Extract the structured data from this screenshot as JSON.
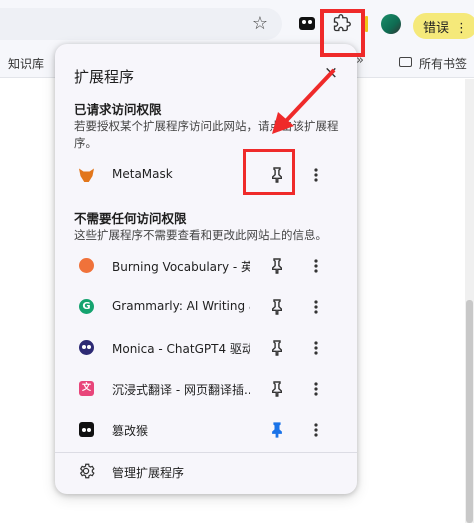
{
  "toolbar": {
    "error_label": "错误",
    "error_more": "⋮",
    "bookmark_star": "☆",
    "bookmarks": {
      "knowledge": "知识库",
      "more": "»",
      "all_bookmarks": "所有书签"
    }
  },
  "popup": {
    "title": "扩展程序",
    "close": "×",
    "requested": {
      "heading": "已请求访问权限",
      "description": "若要授权某个扩展程序访问此网站，请点击该扩展程序。",
      "items": [
        {
          "name": "MetaMask",
          "icon": "metamask-icon",
          "pinned": false
        }
      ]
    },
    "no_access": {
      "heading": "不需要任何访问权限",
      "description": "这些扩展程序不需要查看和更改此网站上的信息。",
      "items": [
        {
          "name": "Burning Vocabulary - 英...",
          "icon": "burning-vocabulary-icon",
          "pinned": false
        },
        {
          "name": "Grammarly: AI Writing a...",
          "icon": "grammarly-icon",
          "icon_text": "G",
          "pinned": false
        },
        {
          "name": "Monica - ChatGPT4 驱动...",
          "icon": "monica-icon",
          "pinned": false
        },
        {
          "name": "沉浸式翻译 - 网页翻译插...",
          "icon": "immersive-translate-icon",
          "icon_text": "文",
          "pinned": false
        },
        {
          "name": "篡改猴",
          "icon": "tampermonkey-icon",
          "pinned": true
        }
      ]
    },
    "manage_label": "管理扩展程序"
  },
  "colors": {
    "pin_active": "#1a73e8",
    "annotation_red": "#ef2a2a",
    "popup_bg": "#f7f6fb"
  }
}
